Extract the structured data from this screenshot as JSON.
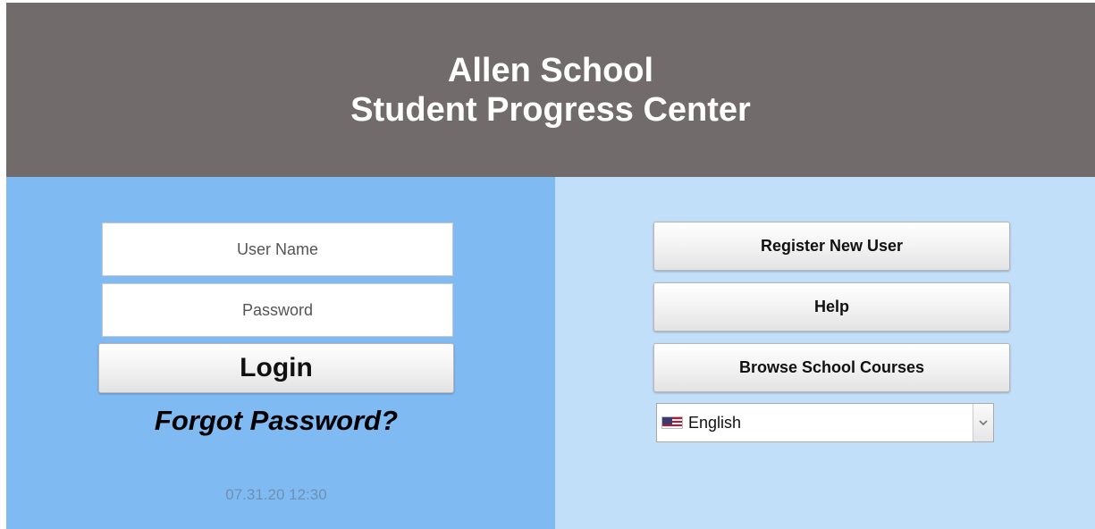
{
  "header": {
    "title_line1": "Allen School",
    "title_line2": "Student Progress Center"
  },
  "login": {
    "username_placeholder": "User Name",
    "password_placeholder": "Password",
    "login_label": "Login",
    "forgot_label": "Forgot Password?",
    "timestamp": "07.31.20 12:30"
  },
  "actions": {
    "register_label": "Register New User",
    "help_label": "Help",
    "browse_label": "Browse School Courses"
  },
  "language": {
    "selected": "English",
    "flag_icon": "us-flag-icon"
  },
  "colors": {
    "header_bg": "#716c6b",
    "left_panel_bg": "#80baf2",
    "right_panel_bg": "#c2dffa"
  }
}
